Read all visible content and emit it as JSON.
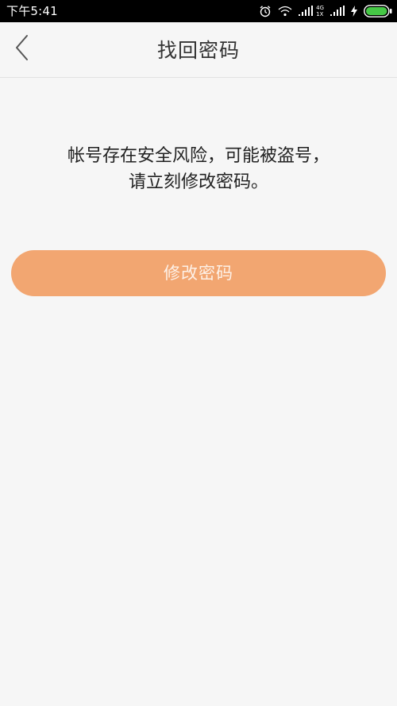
{
  "status_bar": {
    "time": "下午5:41",
    "network_top": "4G",
    "network_bottom": "1X",
    "icons": [
      "alarm-icon",
      "wifi-icon",
      "signal-icon",
      "signal-icon",
      "charging-icon",
      "battery-icon"
    ],
    "battery_color": "#46c846"
  },
  "nav": {
    "title": "找回密码",
    "back_icon": "chevron-left-icon"
  },
  "main": {
    "warning": "帐号存在安全风险，可能被盗号，请立刻修改密码。",
    "button_label": "修改密码",
    "button_color": "#f2a671"
  }
}
